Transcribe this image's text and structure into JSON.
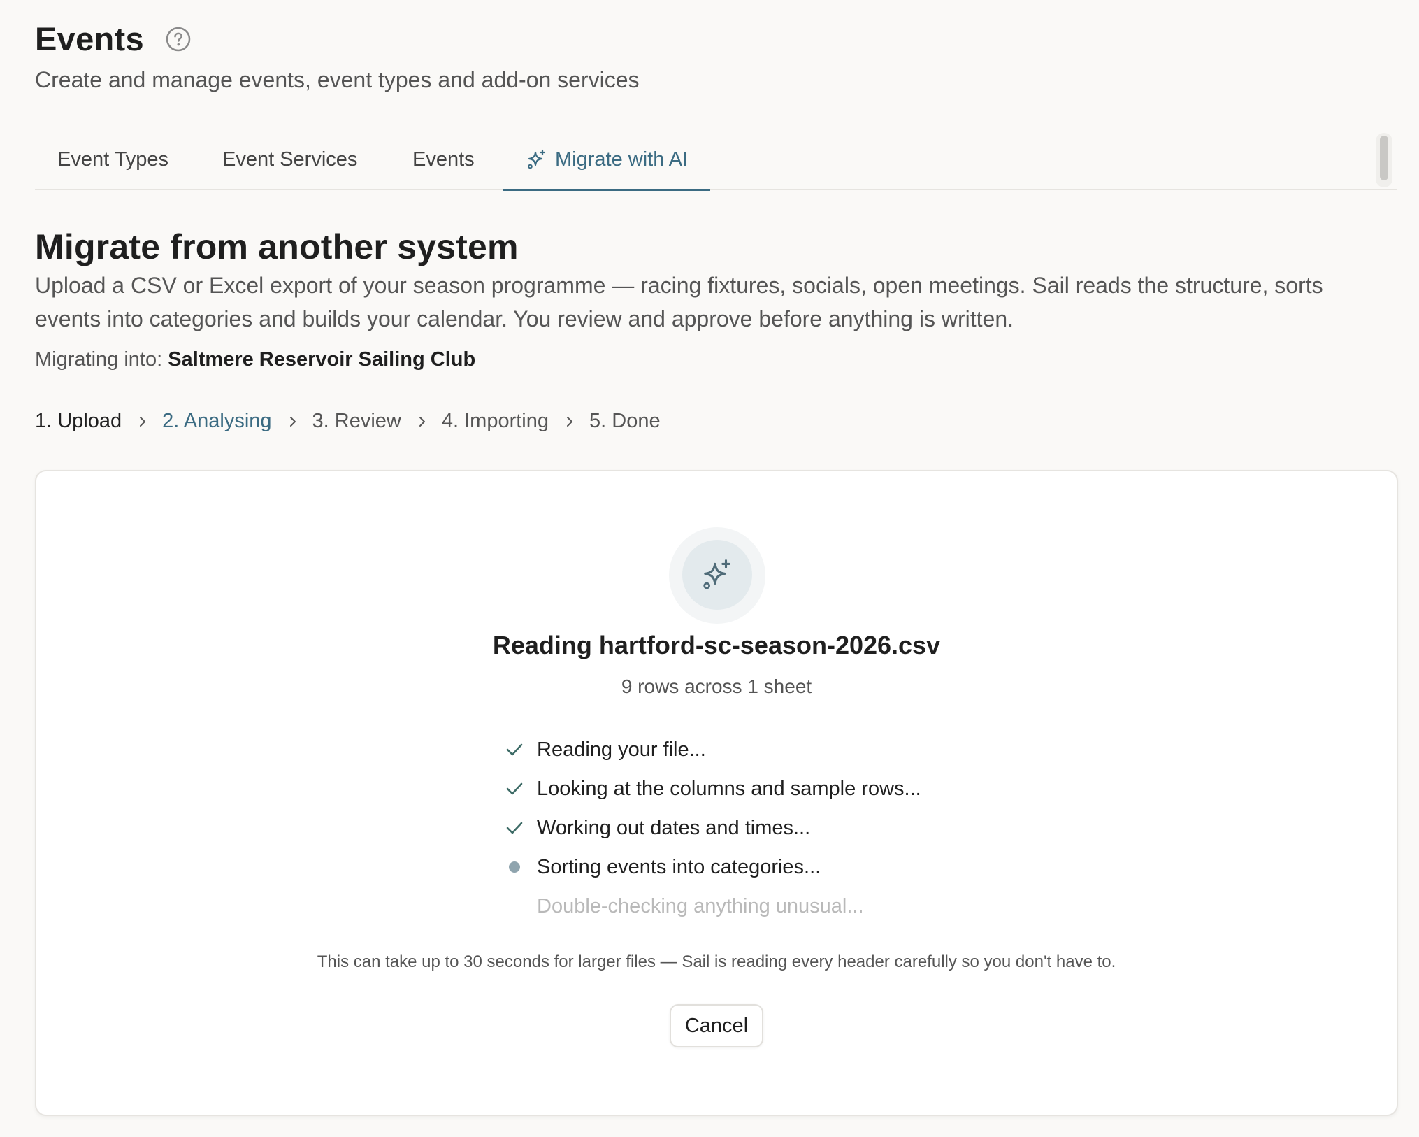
{
  "header": {
    "title": "Events",
    "subtitle": "Create and manage events, event types and add-on services"
  },
  "tabs": [
    {
      "label": "Event Types",
      "active": false
    },
    {
      "label": "Event Services",
      "active": false
    },
    {
      "label": "Events",
      "active": false
    },
    {
      "label": "Migrate with AI",
      "active": true,
      "icon": "sparkles-icon"
    }
  ],
  "migrate": {
    "title": "Migrate from another system",
    "description": "Upload a CSV or Excel export of your season programme — racing fixtures, socials, open meetings. Sail reads the structure, sorts events into categories and builds your calendar. You review and approve before anything is written.",
    "migrating_label": "Migrating into:",
    "club_name": "Saltmere Reservoir Sailing Club"
  },
  "steps": [
    {
      "label": "1. Upload",
      "state": "done"
    },
    {
      "label": "2. Analysing",
      "state": "current"
    },
    {
      "label": "3. Review",
      "state": "upcoming"
    },
    {
      "label": "4. Importing",
      "state": "upcoming"
    },
    {
      "label": "5. Done",
      "state": "upcoming"
    }
  ],
  "analysis": {
    "title": "Reading hartford-sc-season-2026.csv",
    "subtitle": "9 rows across 1 sheet",
    "checklist": [
      {
        "label": "Reading your file...",
        "status": "done"
      },
      {
        "label": "Looking at the columns and sample rows...",
        "status": "done"
      },
      {
        "label": "Working out dates and times...",
        "status": "done"
      },
      {
        "label": "Sorting events into categories...",
        "status": "in-progress"
      },
      {
        "label": "Double-checking anything unusual...",
        "status": "pending"
      }
    ],
    "note": "This can take up to 30 seconds for larger files — Sail is reading every header carefully so you don't have to.",
    "cancel_label": "Cancel"
  },
  "colors": {
    "accent": "#3b6b82",
    "background": "#faf9f7",
    "card": "#ffffff",
    "check": "#3d6b66",
    "pending_text": "#b9b9b9"
  }
}
